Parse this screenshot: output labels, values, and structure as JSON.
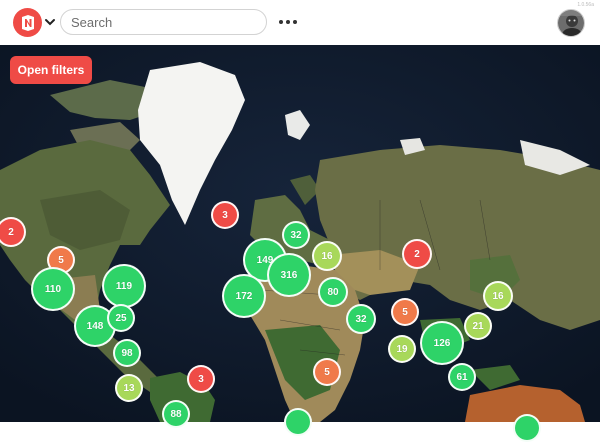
{
  "header": {
    "search_placeholder": "Search",
    "version_label": "1.0.56a"
  },
  "filters": {
    "open_label": "Open filters"
  },
  "colors": {
    "brand": "#ef4b46",
    "cluster_large": "#2ed368",
    "cluster_medium": "#a8d85a",
    "cluster_small_orange": "#f07a4a",
    "cluster_small_red": "#ef4b46"
  },
  "clusters": [
    {
      "id": "c-2-west",
      "count": "2",
      "tier": "red"
    },
    {
      "id": "c-3-atlantic",
      "count": "3",
      "tier": "red"
    },
    {
      "id": "c-5-canada",
      "count": "5",
      "tier": "orange"
    },
    {
      "id": "c-110",
      "count": "110",
      "tier": "green"
    },
    {
      "id": "c-119",
      "count": "119",
      "tier": "green"
    },
    {
      "id": "c-148",
      "count": "148",
      "tier": "green"
    },
    {
      "id": "c-25",
      "count": "25",
      "tier": "green"
    },
    {
      "id": "c-98",
      "count": "98",
      "tier": "green"
    },
    {
      "id": "c-13",
      "count": "13",
      "tier": "lime"
    },
    {
      "id": "c-3-samerica",
      "count": "3",
      "tier": "red"
    },
    {
      "id": "c-88",
      "count": "88",
      "tier": "green"
    },
    {
      "id": "c-32-north",
      "count": "32",
      "tier": "green"
    },
    {
      "id": "c-149",
      "count": "149",
      "tier": "green"
    },
    {
      "id": "c-316",
      "count": "316",
      "tier": "green"
    },
    {
      "id": "c-16-europe",
      "count": "16",
      "tier": "lime"
    },
    {
      "id": "c-172",
      "count": "172",
      "tier": "green"
    },
    {
      "id": "c-80",
      "count": "80",
      "tier": "green"
    },
    {
      "id": "c-2-asia",
      "count": "2",
      "tier": "red"
    },
    {
      "id": "c-32-mideast",
      "count": "32",
      "tier": "green"
    },
    {
      "id": "c-5-india",
      "count": "5",
      "tier": "orange"
    },
    {
      "id": "c-19",
      "count": "19",
      "tier": "lime"
    },
    {
      "id": "c-126",
      "count": "126",
      "tier": "green"
    },
    {
      "id": "c-21",
      "count": "21",
      "tier": "lime"
    },
    {
      "id": "c-16-asia",
      "count": "16",
      "tier": "lime"
    },
    {
      "id": "c-61",
      "count": "61",
      "tier": "green"
    },
    {
      "id": "c-5-africa",
      "count": "5",
      "tier": "orange"
    },
    {
      "id": "c-bottom-africa",
      "count": "",
      "tier": "green"
    },
    {
      "id": "c-bottom-right",
      "count": "",
      "tier": "green"
    }
  ]
}
